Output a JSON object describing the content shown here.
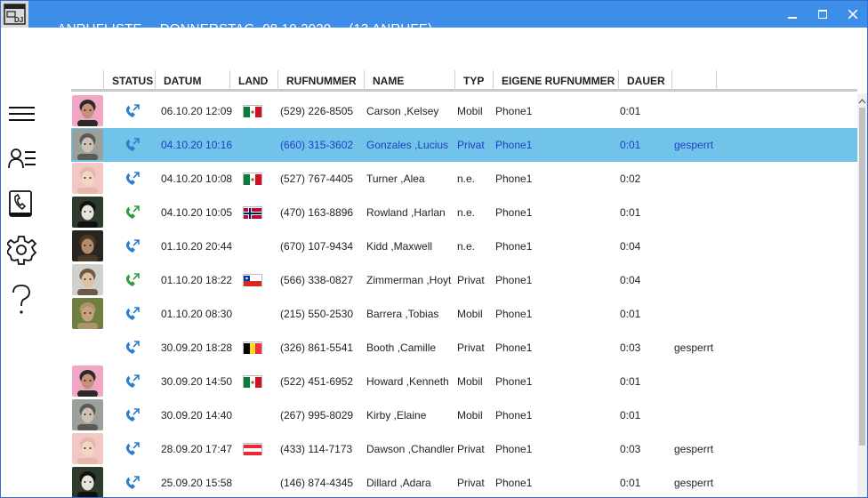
{
  "window": {
    "title_parts": [
      "ANRUFLISTE",
      "DONNERSTAG, 08.10.2020",
      "(13 ANRUFE)"
    ],
    "app_icon_text": "DJ",
    "accent": "#3d8ee8",
    "selected_row_color": "#72c3ea"
  },
  "sidebar": {
    "items": [
      {
        "name": "menu",
        "icon": "hamburger-icon"
      },
      {
        "name": "contacts",
        "icon": "contact-list-icon"
      },
      {
        "name": "phonebook",
        "icon": "phonebook-icon"
      },
      {
        "name": "settings",
        "icon": "gear-icon"
      },
      {
        "name": "help",
        "icon": "question-icon"
      }
    ]
  },
  "table": {
    "columns": [
      "STATUS",
      "DATUM",
      "LAND",
      "RUFNUMMER",
      "NAME",
      "TYP",
      "EIGENE RUFNUMMER",
      "DAUER",
      ""
    ],
    "rows": [
      {
        "avatar": "pink",
        "status": "blue",
        "datum": "06.10.20 12:09",
        "land": "mx",
        "rufnummer": "(529) 226-8505",
        "name": "Carson ,Kelsey",
        "typ": "Mobil",
        "eigene": "Phone1",
        "dauer": "0:01",
        "extra": ""
      },
      {
        "avatar": "grey",
        "status": "blue",
        "datum": "04.10.20 10:16",
        "land": "",
        "rufnummer": "(660) 315-3602",
        "name": "Gonzales ,Lucius",
        "typ": "Privat",
        "eigene": "Phone1",
        "dauer": "0:01",
        "extra": "gesperrt",
        "selected": true
      },
      {
        "avatar": "baby",
        "status": "blue",
        "datum": "04.10.20 10:08",
        "land": "mx",
        "rufnummer": "(527) 767-4405",
        "name": "Turner ,Alea",
        "typ": "n.e.",
        "eigene": "Phone1",
        "dauer": "0:02",
        "extra": ""
      },
      {
        "avatar": "dark",
        "status": "green",
        "datum": "04.10.20 10:05",
        "land": "no",
        "rufnummer": "(470) 163-8896",
        "name": "Rowland ,Harlan",
        "typ": "n.e.",
        "eigene": "Phone1",
        "dauer": "0:01",
        "extra": ""
      },
      {
        "avatar": "brown",
        "status": "blue",
        "datum": "01.10.20 20:44",
        "land": "",
        "rufnummer": "(670) 107-9434",
        "name": "Kidd ,Maxwell",
        "typ": "n.e.",
        "eigene": "Phone1",
        "dauer": "0:04",
        "extra": ""
      },
      {
        "avatar": "light",
        "status": "green",
        "datum": "01.10.20 18:22",
        "land": "cl",
        "rufnummer": "(566) 338-0827",
        "name": "Zimmerman ,Hoyt",
        "typ": "Privat",
        "eigene": "Phone1",
        "dauer": "0:04",
        "extra": ""
      },
      {
        "avatar": "olive",
        "status": "blue",
        "datum": "01.10.20 08:30",
        "land": "",
        "rufnummer": "(215) 550-2530",
        "name": "Barrera ,Tobias",
        "typ": "Mobil",
        "eigene": "Phone1",
        "dauer": "0:01",
        "extra": ""
      },
      {
        "avatar": "",
        "status": "blue",
        "datum": "30.09.20 18:28",
        "land": "be",
        "rufnummer": "(326) 861-5541",
        "name": "Booth ,Camille",
        "typ": "Privat",
        "eigene": "Phone1",
        "dauer": "0:03",
        "extra": "gesperrt"
      },
      {
        "avatar": "pink",
        "status": "blue",
        "datum": "30.09.20 14:50",
        "land": "mx",
        "rufnummer": "(522) 451-6952",
        "name": "Howard ,Kenneth",
        "typ": "Mobil",
        "eigene": "Phone1",
        "dauer": "0:01",
        "extra": ""
      },
      {
        "avatar": "grey",
        "status": "blue",
        "datum": "30.09.20 14:40",
        "land": "",
        "rufnummer": "(267) 995-8029",
        "name": "Kirby ,Elaine",
        "typ": "Mobil",
        "eigene": "Phone1",
        "dauer": "0:01",
        "extra": ""
      },
      {
        "avatar": "baby",
        "status": "blue",
        "datum": "28.09.20 17:47",
        "land": "at",
        "rufnummer": "(433) 114-7173",
        "name": "Dawson ,Chandler",
        "typ": "Privat",
        "eigene": "Phone1",
        "dauer": "0:03",
        "extra": "gesperrt"
      },
      {
        "avatar": "dark",
        "status": "blue",
        "datum": "25.09.20 15:58",
        "land": "",
        "rufnummer": "(146) 874-4345",
        "name": "Dillard ,Adara",
        "typ": "Privat",
        "eigene": "Phone1",
        "dauer": "0:01",
        "extra": "gesperrt"
      }
    ]
  }
}
